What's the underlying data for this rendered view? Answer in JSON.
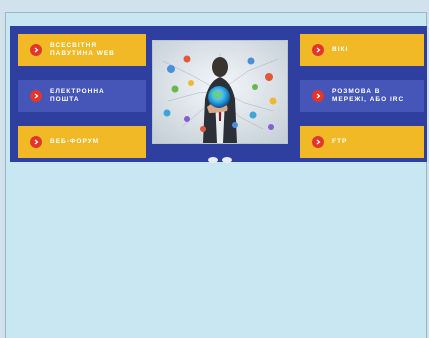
{
  "menu": {
    "left": [
      {
        "label": "ВСЕСВІТНЯ\nПАВУТИНА WEB",
        "style": "yellow"
      },
      {
        "label": "ЕЛЕКТРОННА\nПОШТА",
        "style": "blue"
      },
      {
        "label": "ВЕБ-ФОРУМ",
        "style": "yellow"
      }
    ],
    "right": [
      {
        "label": "ВІКІ",
        "style": "yellow"
      },
      {
        "label": "РОЗМОВА В\nМЕРЕЖІ, АБО IRC",
        "style": "blue"
      },
      {
        "label": "FTP",
        "style": "yellow"
      }
    ]
  },
  "colors": {
    "panel": "#2f3fa0",
    "yellow_button": "#f0b925",
    "blue_button": "#4556b8",
    "arrow": "#e3362b",
    "content_area": "#c9e7f3"
  },
  "image": {
    "icon": "businessman-globe-network-image"
  }
}
